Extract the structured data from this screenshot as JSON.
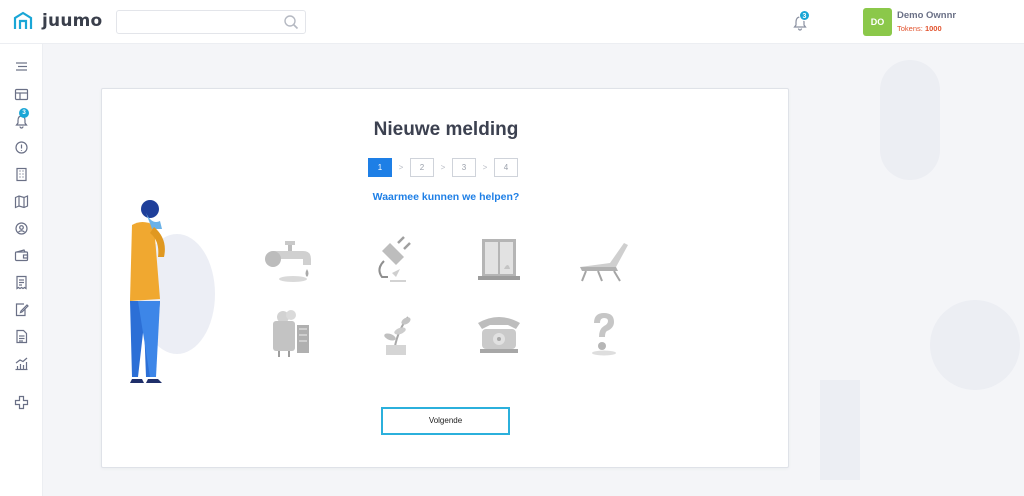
{
  "header": {
    "logo_text": "juumo",
    "search": {
      "placeholder": ""
    },
    "notifications": {
      "count": "3"
    },
    "user": {
      "initials": "DO",
      "name": "Demo Ownnr",
      "tokens_label": "Tokens:",
      "tokens_value": "1000"
    }
  },
  "sidebar": {
    "items": [
      {
        "icon": "menu-icon"
      },
      {
        "icon": "dashboard-icon"
      },
      {
        "icon": "bell-icon",
        "badge": "3"
      },
      {
        "icon": "alert-icon"
      },
      {
        "icon": "building-icon"
      },
      {
        "icon": "map-icon"
      },
      {
        "icon": "contacts-icon"
      },
      {
        "icon": "wallet-icon"
      },
      {
        "icon": "invoice-icon"
      },
      {
        "icon": "edit-document-icon"
      },
      {
        "icon": "document-icon"
      },
      {
        "icon": "chart-icon"
      },
      {
        "icon": "plus-icon"
      }
    ]
  },
  "modal": {
    "title": "Nieuwe melding",
    "steps": [
      "1",
      "2",
      "3",
      "4"
    ],
    "active_step": 1,
    "question": "Waarmee kunnen we helpen?",
    "options": [
      {
        "icon": "faucet-icon"
      },
      {
        "icon": "plug-icon"
      },
      {
        "icon": "window-icon"
      },
      {
        "icon": "lounge-chair-icon"
      },
      {
        "icon": "boiler-icon"
      },
      {
        "icon": "plant-icon"
      },
      {
        "icon": "telephone-icon"
      },
      {
        "icon": "question-mark-icon"
      }
    ],
    "next_label": "Volgende"
  },
  "colors": {
    "accent": "#1e7fe6",
    "button_border": "#2bb0dc",
    "avatar": "#8bc84a",
    "tokens": "#e2542f",
    "badge": "#1aa6d6"
  }
}
